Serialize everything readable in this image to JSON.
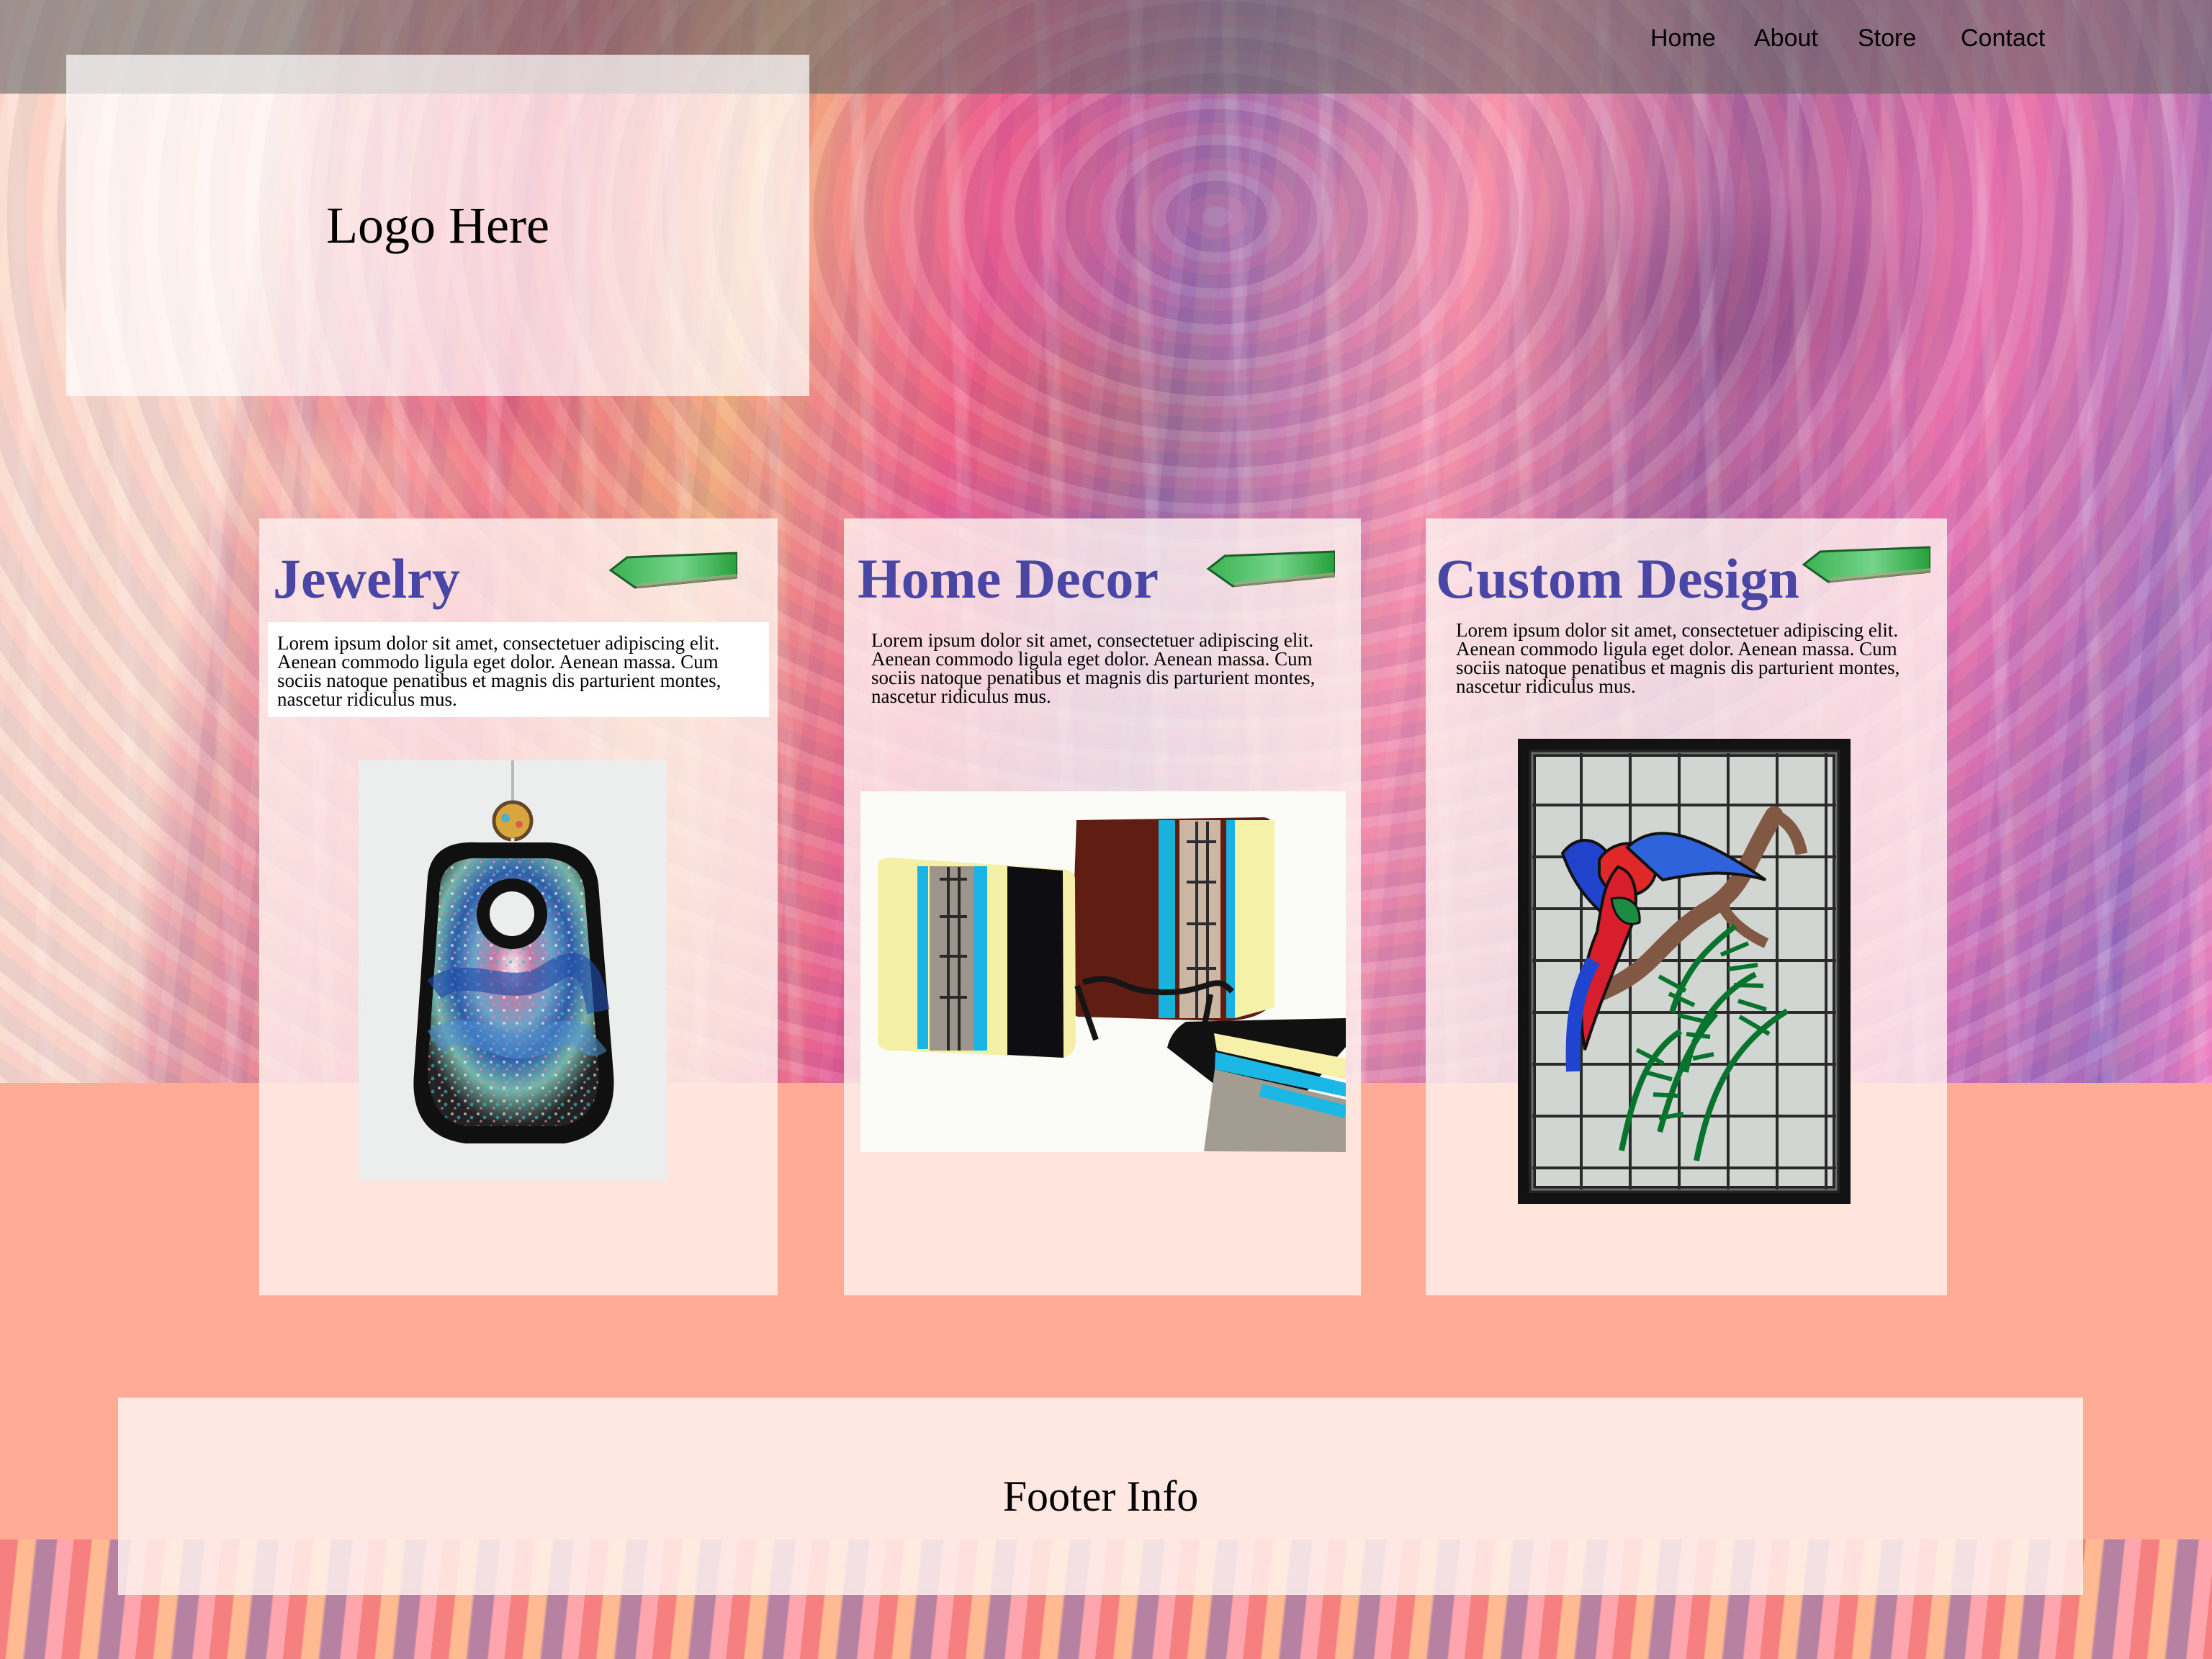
{
  "nav": {
    "items": [
      "Home",
      "About",
      "Store",
      "Contact"
    ]
  },
  "logo": {
    "text": "Logo Here"
  },
  "cards": [
    {
      "title": "Jewelry",
      "text": "Lorem ipsum dolor sit amet, consectetuer adipiscing elit. Aenean commodo ligula eget dolor. Aenean massa. Cum sociis natoque penatibus et magnis dis parturient montes, nascetur ridiculus mus.",
      "image": "jewelry-pendant-image"
    },
    {
      "title": "Home Decor",
      "text": "Lorem ipsum dolor sit amet, consectetuer adipiscing elit. Aenean commodo ligula eget dolor. Aenean massa. Cum sociis natoque penatibus et magnis dis parturient montes, nascetur ridiculus mus.",
      "image": "glass-plates-image"
    },
    {
      "title": "Custom Design",
      "text": "Lorem ipsum dolor sit amet, consectetuer adipiscing elit. Aenean commodo ligula eget dolor. Aenean massa. Cum sociis natoque penatibus et magnis dis parturient montes, nascetur ridiculus mus.",
      "image": "stained-glass-parrot-image"
    }
  ],
  "footer": {
    "text": "Footer Info"
  },
  "colors": {
    "title_purple": "#4a46a5",
    "salmon_background": "#ffab95",
    "nav_overlay": "#686868"
  }
}
